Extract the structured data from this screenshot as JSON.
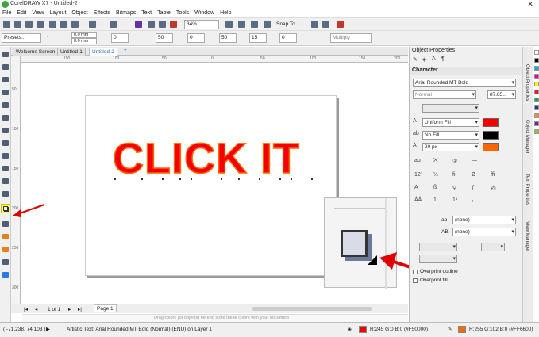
{
  "window": {
    "title": "CorelDRAW X7 - Untitled-2",
    "close_glyph": "✕"
  },
  "menu": [
    "File",
    "Edit",
    "View",
    "Layout",
    "Object",
    "Effects",
    "Bitmaps",
    "Text",
    "Table",
    "Tools",
    "Window",
    "Help"
  ],
  "toolbar": {
    "zoom": "34%",
    "snap_to": "Snap To",
    "presets": "Presets...",
    "width": "0.0 mm",
    "height": "0.0 mm",
    "x1": "0",
    "y1": "50",
    "y2": "0",
    "x2": "50",
    "x3": "15",
    "x4": "0",
    "merge_mode": "Multiply"
  },
  "tabs": [
    "Welcome Screen",
    "Untitled-1",
    "Untitled-2"
  ],
  "ruler": {
    "h_ticks": [
      "150",
      "100",
      "50",
      "0",
      "50",
      "100",
      "150",
      "200"
    ],
    "v_ticks": [
      "50",
      "100",
      "150",
      "200",
      "250",
      "300"
    ]
  },
  "canvas": {
    "artistic_text": "CLICK IT",
    "text_color": "#F50000",
    "outline_color": "#FF6600"
  },
  "bottom": {
    "page_count": "1 of 1",
    "page_tab": "Page 1",
    "drag_hint": "Drag colors (or objects) here to store these colors with your document"
  },
  "status": {
    "coords": "( -71.238, 74.103 )",
    "object_info": "Artistic Text: Arial Rounded MT Bold (Normal) (ENU) on Layer 1",
    "fill_label": "R:245 G:0 B:0 (#F50000)",
    "outline_label": "R:255 G:102 B:0 (#FF6600)"
  },
  "panel": {
    "title": "Object Properties",
    "character": "Character",
    "font": "Arial Rounded MT Bold",
    "style": "Normal",
    "size": "87.85...",
    "fill_type": "Uniform Fill",
    "outline_type": "No Fill",
    "outline_width": "20 px",
    "underline_a": "(none)",
    "underline_b": "(none)",
    "overprint_outline": "Overprint outline",
    "overprint_fill": "Overprint fill",
    "label_ab": "ab",
    "label_AB": "AB"
  },
  "dock_labels": [
    "Object Properties",
    "Object Manager",
    "Text Properties",
    "View Manager"
  ],
  "colors": {
    "fill": "#F50000",
    "outline": "#FF6600",
    "highlight": "#FFFF66",
    "arrow": "#E00000"
  }
}
